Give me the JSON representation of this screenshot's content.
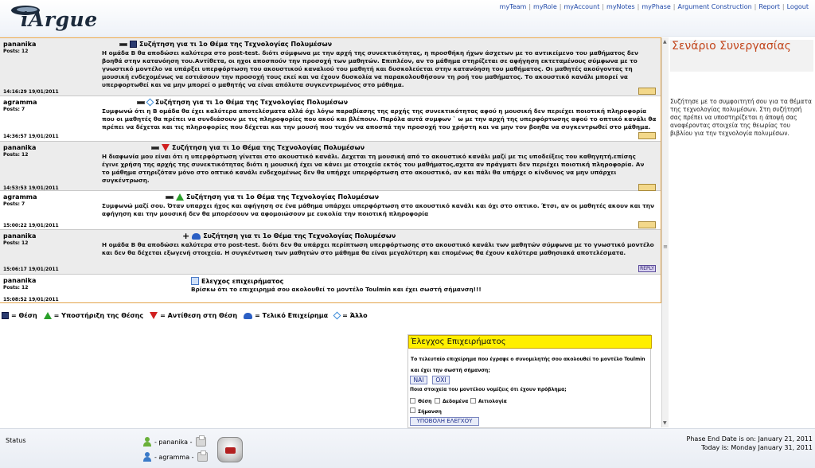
{
  "app": {
    "logo_text": "iArgue"
  },
  "nav": {
    "items": [
      "myTeam",
      "myRole",
      "myAccount",
      "myNotes",
      "myPhase",
      "Argument Construction",
      "Report",
      "Logout"
    ],
    "separator": "|"
  },
  "messages": [
    {
      "author": "pananika",
      "posts": "Posts: 12",
      "timestamp": "14:16:29 19/01/2011",
      "subject": "Συζήτηση για τι 1ο Θέμα της Τεχνολογίας Πολυμέσων",
      "icons": [
        "dash",
        "square"
      ],
      "body": "Η ομάδα Β θα αποδώσει καλύτερα στο post-test. διότι σύμφωνα με την αρχή της συνεκτικότητας, η προσθήκη ήχων άσχετων με το αντικείμενο του μαθήματος δεν βοηθά στην κατανόηση του.Αντίθετα, οι ηχοι αποσπούν την προσοχή των μαθητών. Επιπλέον, αν το μάθημα στηρίζεται σε αφήγηση εκτεταμένους σύμφωνα με το γνωστικό μοντέλο να υπάρξει υπερφόρτωση του ακουστικού καναλιού του μαθητή και δυσκολεύεται στην κατανόηση του μαθήματος. Οι μαθητές ακούγοντας τη μουσική ενδεχομένως να εστιάσουν την προσοχή τους εκεί και να έχουν δυσκολία να παρακολουθήσουν τη ροή του μαθήματος. Το ακουστικό κανάλι μπορεί να υπερφορτωθεί και να μην μπορεί ο μαθητής να είναι απόλυτα συγκεντρωμένος στο μάθημα.",
      "reply": ""
    },
    {
      "author": "agramma",
      "posts": "Posts: 7",
      "timestamp": "14:36:57 19/01/2011",
      "subject": "Συζήτηση για τι 1ο Θέμα της Τεχνολογίας Πολυμέσων",
      "icons": [
        "dash",
        "diamond"
      ],
      "body": "Συμφωνώ ότι η Β ομάδα θα έχει καλύτερα αποτελέσματα αλλά όχι λόγω παραβίασης της αρχής της συνεκτικότητας αφού η μουσική δεν περιέχει ποιοτική πληροφορία που οι μαθητές θα πρέπει να συνδιάσουν με τις πληροφορίες που ακού και βλέπουν. Παρόλα αυτά συμφων ` ω με την αρχή της υπερφόρτωσης αφού το οπτικό κανάλι θα πρέπει να δέχεται και τις πληροφορίες που δέχεται και την μουσή που τυχόν να αποσπά την προσοχή του χρήστη και να μην τον βοηθα να συγκεντρωθεί στο μάθημα.",
      "reply": ""
    },
    {
      "author": "pananika",
      "posts": "Posts: 12",
      "timestamp": "14:53:53 19/01/2011",
      "subject": "Συζήτηση για τι 1ο Θέμα της Τεχνολογίας Πολυμέσων",
      "icons": [
        "dash",
        "tri-down"
      ],
      "body": "Η διαφωνία μου είναι ότι η υπερφόρτωση γίνεται στο ακουστικό κανάλι. Δεχεται τη μουσική από το ακουστικό κανάλι μαζί με τις υποδείξεις του καθηγητή.επίσης έγινε χρήση της αρχής της συνεκτικότητας διότι η μουσική έχει να κάνει με στοιχεία εκτός του μαθήματος,αχετα αν πράγματι δεν περιέχει ποιοτική πληροφορία. Αν το μάθημα στηριζόταν μόνο στο οπτικό κανάλι ενδεχομένως δεν θα υπήρχε υπερφόρτωση στο ακουστικό, αν και πάλι θα υπήρχε ο κίνδυνος να μην υπάρχει συγκέντρωση.",
      "reply": ""
    },
    {
      "author": "agramma",
      "posts": "Posts: 7",
      "timestamp": "15:00:22 19/01/2011",
      "subject": "Συζήτηση για τι 1ο Θέμα της Τεχνολογίας Πολυμέσων",
      "icons": [
        "dash",
        "tri-up"
      ],
      "body": "Συμφωνώ μαζί σου. Όταν υπαρχει ήχος και αφήγηση σε ένα μάθημα υπάρχει υπερφόρτωση στο ακουστικό κανάλι και όχι στο οπτικο. Έτσι, αν οι μαθητές ακουν και την αφήγηση και την μουσική δεν θα μπορέσουν να αφομοιώσουν με ευκολία την ποιοτική πληροφορία",
      "reply": ""
    },
    {
      "author": "pananika",
      "posts": "Posts: 12",
      "timestamp": "15:06:17 19/01/2011",
      "subject": "Συζήτηση για τι 1ο Θέμα της Τεχνολογίας Πολυμέσων",
      "icons": [
        "plus",
        "cloud"
      ],
      "body": "Η ομάδα Β θα αποδώσει καλύτερα στο post-test. διότι δεν θα υπάρχει περίπτωση υπερφόρτωσης στο ακουστικό κανάλι των μαθητών σύμφωνα με το γνωστικό μοντέλο και δεν θα δέχεται εξωγενή στοιχεία. Η συγκέντωση των μαθητών στο μάθημα θα είναι μεγαλύτερη και επομένως θα έχουν καλύτερα μαθησιακά αποτελέσματα.",
      "reply": "REPLY"
    },
    {
      "author": "pananika",
      "posts": "Posts: 12",
      "timestamp": "15:08:52 19/01/2011",
      "subject": "Ελεγχος επιχειρήματος",
      "icons": [
        "check"
      ],
      "body": "Βρίσκω ότι το επιχειρημά σου ακολουθεί το μοντέλο Toulmin και έχει σωστή σήμανση!!!",
      "reply": ""
    }
  ],
  "side": {
    "title": "Σενάριο Συνεργασίας",
    "text": "Συζήτησε με το συμφοιτητή σου για τα θέματα της τεχνολογίας πολυμέσων. Στη συζήτησή σας πρέπει να υποστηρίζεται η άποψή σας αναφέροντας στοιχεία της θεωρίας του βιβλίου για την τεχνολογία πολυμέσων."
  },
  "legend": [
    {
      "icon": "square",
      "label": "= Θέση"
    },
    {
      "icon": "tri-up",
      "label": "= Υποστήριξη της Θέσης"
    },
    {
      "icon": "tri-down",
      "label": "= Αντίθεση στη Θέση"
    },
    {
      "icon": "cloud",
      "label": "= Τελικό Επιχείρημα"
    },
    {
      "icon": "diamond",
      "label": "= Άλλο"
    }
  ],
  "argument_check": {
    "title": "Έλεγχος Επιχειρήματος",
    "question1": "Το τελευταίο επιχείρημα που έγραψε ο συνομιλητής σου ακολουθεί το μοντέλο Toulmin και έχει την σωστή σήμανση;",
    "yes": "ΝΑΙ",
    "no": "ΟΧΙ",
    "question2": "Ποια στοιχεία του μοντέλου νομίζεις ότι έχουν πρόβλημα;",
    "options": [
      "Θέση",
      "Δεδομένα",
      "Αιτιολογία",
      "Σήμανση"
    ],
    "submit": "ΥΠΟΒΟΛΗ ΕΛΕΓΧΟΥ"
  },
  "footer": {
    "status_label": "Status",
    "users": [
      {
        "name": "- pananika -",
        "color": "#6ab03a"
      },
      {
        "name": "- agramma -",
        "color": "#3a7ac8"
      }
    ],
    "phase_end": "Phase End Date is on: January 21, 2011",
    "today": "Today is: Monday January 31, 2011"
  },
  "colors": {
    "accent": "#c2461c",
    "nav_link": "#1f48a8",
    "panel_border": "#e3a44a",
    "check_title_bg": "#ffef00"
  }
}
